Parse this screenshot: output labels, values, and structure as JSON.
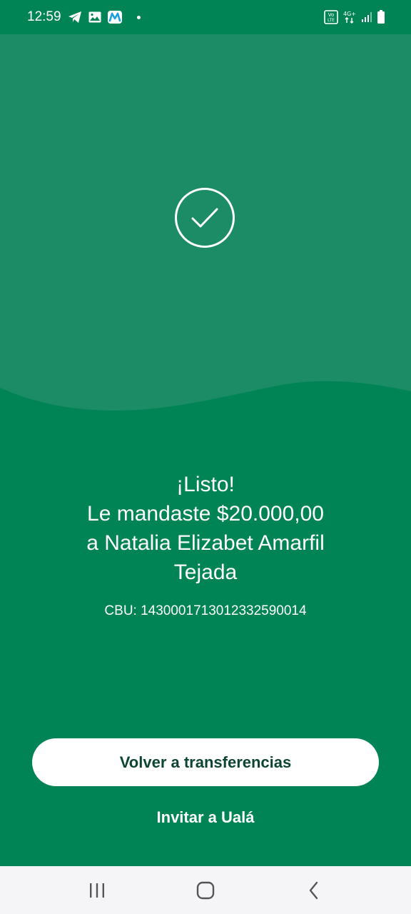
{
  "status_bar": {
    "time": "12:59",
    "icons_left": [
      "telegram-icon",
      "gallery-icon",
      "movistar-icon",
      "notification-dot"
    ],
    "icons_right": [
      "volte-icon",
      "4g-icon",
      "signal-icon",
      "battery-icon"
    ],
    "network_label": "4G+",
    "volte_label": "Vo LTE"
  },
  "success": {
    "icon": "check-circle-icon",
    "title": "¡Listo!",
    "line1": "Le mandaste $20.000,00",
    "line2": "a Natalia Elizabet Amarfil",
    "line3": "Tejada",
    "cbu_text": "CBU: 1430001713012332590014"
  },
  "actions": {
    "primary_label": "Volver a transferencias",
    "secondary_label": "Invitar a Ualá"
  },
  "nav_bar": {
    "buttons": [
      "recents-icon",
      "home-icon",
      "back-icon"
    ]
  },
  "colors": {
    "background": "#008455",
    "hero": "#1b8c66",
    "primary_button_bg": "#ffffff",
    "primary_button_text": "#0d4433",
    "nav_bar": "#f5f5f7"
  }
}
